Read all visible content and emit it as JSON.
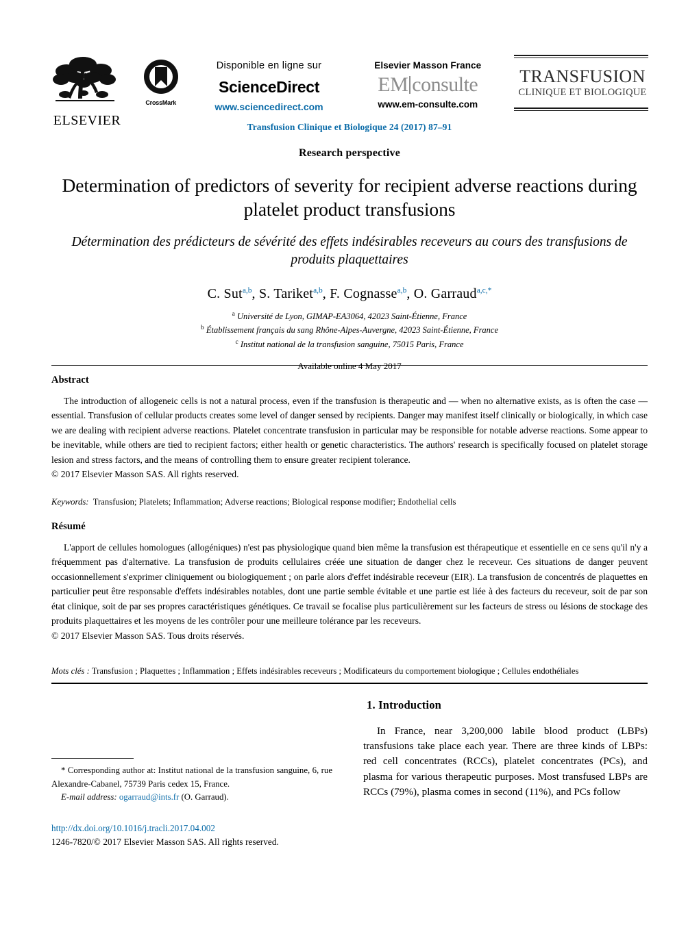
{
  "header": {
    "elsevier_wordmark": "ELSEVIER",
    "crossmark_label": "CrossMark",
    "sciencedirect": {
      "available_line": "Disponible en ligne sur",
      "name": "ScienceDirect",
      "url": "www.sciencedirect.com"
    },
    "emconsulte": {
      "publisher_line": "Elsevier Masson France",
      "logo_left": "EM",
      "logo_right": "consulte",
      "url": "www.em-consulte.com"
    },
    "journal_masthead": {
      "title": "TRANSFUSION",
      "subtitle": "CLINIQUE ET BIOLOGIQUE"
    },
    "journal_reference": "Transfusion Clinique et Biologique 24 (2017) 87–91"
  },
  "article": {
    "type": "Research perspective",
    "title": "Determination of predictors of severity for recipient adverse reactions during platelet product transfusions",
    "subtitle_fr": "Détermination des prédicteurs de sévérité des effets indésirables receveurs au cours des transfusions de produits plaquettaires",
    "authors": [
      {
        "name": "C. Sut",
        "sup": "a,b"
      },
      {
        "name": "S. Tariket",
        "sup": "a,b"
      },
      {
        "name": "F. Cognasse",
        "sup": "a,b"
      },
      {
        "name": "O. Garraud",
        "sup": "a,c,*"
      }
    ],
    "affiliations": [
      {
        "marker": "a",
        "text": "Université de Lyon, GIMAP-EA3064, 42023 Saint-Étienne, France"
      },
      {
        "marker": "b",
        "text": "Établissement français du sang Rhône-Alpes-Auvergne, 42023 Saint-Étienne, France"
      },
      {
        "marker": "c",
        "text": "Institut national de la transfusion sanguine, 75015 Paris, France"
      }
    ],
    "available_online": "Available online 4 May 2017"
  },
  "abstract": {
    "heading": "Abstract",
    "text": "The introduction of allogeneic cells is not a natural process, even if the transfusion is therapeutic and — when no alternative exists, as is often the case — essential. Transfusion of cellular products creates some level of danger sensed by recipients. Danger may manifest itself clinically or biologically, in which case we are dealing with recipient adverse reactions. Platelet concentrate transfusion in particular may be responsible for notable adverse reactions. Some appear to be inevitable, while others are tied to recipient factors; either health or genetic characteristics. The authors' research is specifically focused on platelet storage lesion and stress factors, and the means of controlling them to ensure greater recipient tolerance.",
    "copyright": "© 2017 Elsevier Masson SAS. All rights reserved."
  },
  "keywords": {
    "label": "Keywords:",
    "value": "Transfusion; Platelets; Inflammation; Adverse reactions; Biological response modifier; Endothelial cells"
  },
  "resume": {
    "heading": "Résumé",
    "text": "L'apport de cellules homologues (allogéniques) n'est pas physiologique quand bien même la transfusion est thérapeutique et essentielle en ce sens qu'il n'y a fréquemment pas d'alternative. La transfusion de produits cellulaires créée une situation de danger chez le receveur. Ces situations de danger peuvent occasionnellement s'exprimer cliniquement ou biologiquement ; on parle alors d'effet indésirable receveur (EIR). La transfusion de concentrés de plaquettes en particulier peut être responsable d'effets indésirables notables, dont une partie semble évitable et une partie est liée à des facteurs du receveur, soit de par son état clinique, soit de par ses propres caractéristiques génétiques. Ce travail se focalise plus particulièrement sur les facteurs de stress ou lésions de stockage des produits plaquettaires et les moyens de les contrôler pour une meilleure tolérance par les receveurs.",
    "copyright": "© 2017 Elsevier Masson SAS. Tous droits réservés."
  },
  "motscles": {
    "label": "Mots clés :",
    "value": "Transfusion ; Plaquettes ; Inflammation ; Effets indésirables receveurs ; Modificateurs du comportement biologique ; Cellules endothéliales"
  },
  "introduction": {
    "heading": "1. Introduction",
    "paragraph": "In France, near 3,200,000 labile blood product (LBPs) transfusions take place each year. There are three kinds of LBPs: red cell concentrates (RCCs), platelet concentrates (PCs), and plasma for various therapeutic purposes. Most transfused LBPs are RCCs (79%), plasma comes in second (11%), and PCs follow"
  },
  "footnote": {
    "corresponding_marker": "*",
    "corresponding_text": "Corresponding author at: Institut national de la transfusion sanguine, 6, rue Alexandre-Cabanel, 75739 Paris cedex 15, France.",
    "email_label": "E-mail address:",
    "email": "ogarraud@ints.fr",
    "email_attrib": "(O. Garraud)."
  },
  "footer": {
    "doi": "http://dx.doi.org/10.1016/j.tracli.2017.04.002",
    "issn_line": "1246-7820/© 2017 Elsevier Masson SAS. All rights reserved."
  },
  "colors": {
    "link": "#0a6ba8",
    "text": "#000000",
    "masthead_gray": "#8c8c8c"
  }
}
